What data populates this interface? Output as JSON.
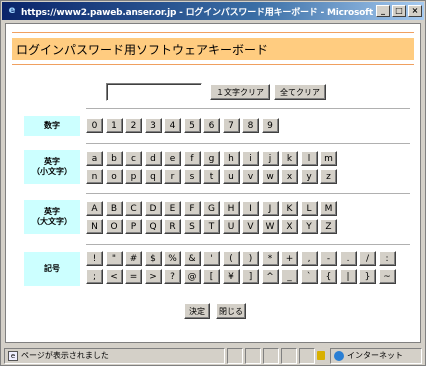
{
  "window": {
    "title": "https://www2.paweb.anser.or.jp - ログインパスワード用キーボード - Microsoft Internet Explorer",
    "minimize_glyph": "_",
    "maximize_glyph": "□",
    "close_glyph": "×"
  },
  "header": {
    "title": "ログインパスワード用ソフトウェアキーボード"
  },
  "input": {
    "value": ""
  },
  "toolbar": {
    "clear_one_label": "１文字クリア",
    "clear_all_label": "全てクリア"
  },
  "rows": {
    "digits": {
      "label": "数字",
      "keys": [
        "0",
        "1",
        "2",
        "3",
        "4",
        "5",
        "6",
        "7",
        "8",
        "9"
      ]
    },
    "lower": {
      "label_line1": "英字",
      "label_line2": "（小文字）",
      "keys_row1": [
        "a",
        "b",
        "c",
        "d",
        "e",
        "f",
        "g",
        "h",
        "i",
        "j",
        "k",
        "l",
        "m"
      ],
      "keys_row2": [
        "n",
        "o",
        "p",
        "q",
        "r",
        "s",
        "t",
        "u",
        "v",
        "w",
        "x",
        "y",
        "z"
      ]
    },
    "upper": {
      "label_line1": "英字",
      "label_line2": "（大文字）",
      "keys_row1": [
        "A",
        "B",
        "C",
        "D",
        "E",
        "F",
        "G",
        "H",
        "I",
        "J",
        "K",
        "L",
        "M"
      ],
      "keys_row2": [
        "N",
        "O",
        "P",
        "Q",
        "R",
        "S",
        "T",
        "U",
        "V",
        "W",
        "X",
        "Y",
        "Z"
      ]
    },
    "symbols": {
      "label": "記号",
      "keys_row1": [
        "!",
        "\"",
        "#",
        "$",
        "%",
        "&",
        "'",
        "(",
        ")",
        "*",
        "+",
        ",",
        "-",
        ".",
        "/",
        ":"
      ],
      "keys_row2": [
        ";",
        "<",
        "=",
        ">",
        "?",
        "@",
        "[",
        "¥",
        "]",
        "^",
        "_",
        "`",
        "{",
        "|",
        "}",
        "~"
      ]
    }
  },
  "footer": {
    "ok_label": "決定",
    "close_label": "閉じる"
  },
  "status": {
    "text": "ページが表示されました",
    "zone": "インターネット"
  }
}
